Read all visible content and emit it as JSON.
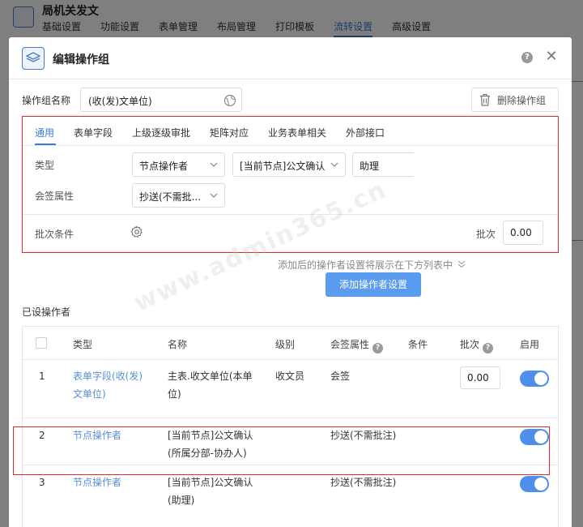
{
  "app": {
    "title": "局机关发文",
    "tabs": [
      "基础设置",
      "功能设置",
      "表单管理",
      "布局管理",
      "打印模板",
      "流转设置",
      "高级设置"
    ],
    "active_tab": 5
  },
  "modal": {
    "title": "编辑操作组",
    "name_label": "操作组名称",
    "name_value": "(收(发)文单位)",
    "delete_label": "删除操作组",
    "tabs": [
      "通用",
      "表单字段",
      "上级逐级审批",
      "矩阵对应",
      "业务表单相关",
      "外部接口"
    ],
    "active_tab": 0,
    "type_label": "类型",
    "type_select": "节点操作者",
    "node_select": "[当前节点]公文确认",
    "role_select": "助理",
    "sign_label": "会签属性",
    "sign_select": "抄送(不需批...",
    "batch_cond_label": "批次条件",
    "batch_label": "批次",
    "batch_value": "0.00",
    "hint": "添加后的操作者设置将展示在下方列表中",
    "add_button": "添加操作者设置",
    "section_title": "已设操作者"
  },
  "table": {
    "headers": {
      "type": "类型",
      "name": "名称",
      "level": "级别",
      "sign": "会签属性",
      "condition": "条件",
      "batch": "批次",
      "enabled": "启用"
    },
    "rows": [
      {
        "index": "1",
        "type_l1": "表单字段(收(发)",
        "type_l2": "文单位)",
        "name_l1": "主表.收文单位(本单",
        "name_l2": "位)",
        "level": "收文员",
        "sign": "会签",
        "batch": "0.00",
        "enabled": true
      },
      {
        "index": "2",
        "type_l1": "节点操作者",
        "name_l1": "[当前节点]公文确认",
        "name_l2": "(所属分部-协办人)",
        "sign": "抄送(不需批注)",
        "enabled": true
      },
      {
        "index": "3",
        "type_l1": "节点操作者",
        "name_l1": "[当前节点]公文确认",
        "name_l2": "(助理)",
        "sign": "抄送(不需批注)",
        "enabled": true
      }
    ]
  },
  "watermark": "www.admin365.cn",
  "colors": {
    "accent": "#3a7bd5",
    "button": "#5a9cf0",
    "toggle": "#4d8fea",
    "highlight_border": "#e02b2b"
  }
}
